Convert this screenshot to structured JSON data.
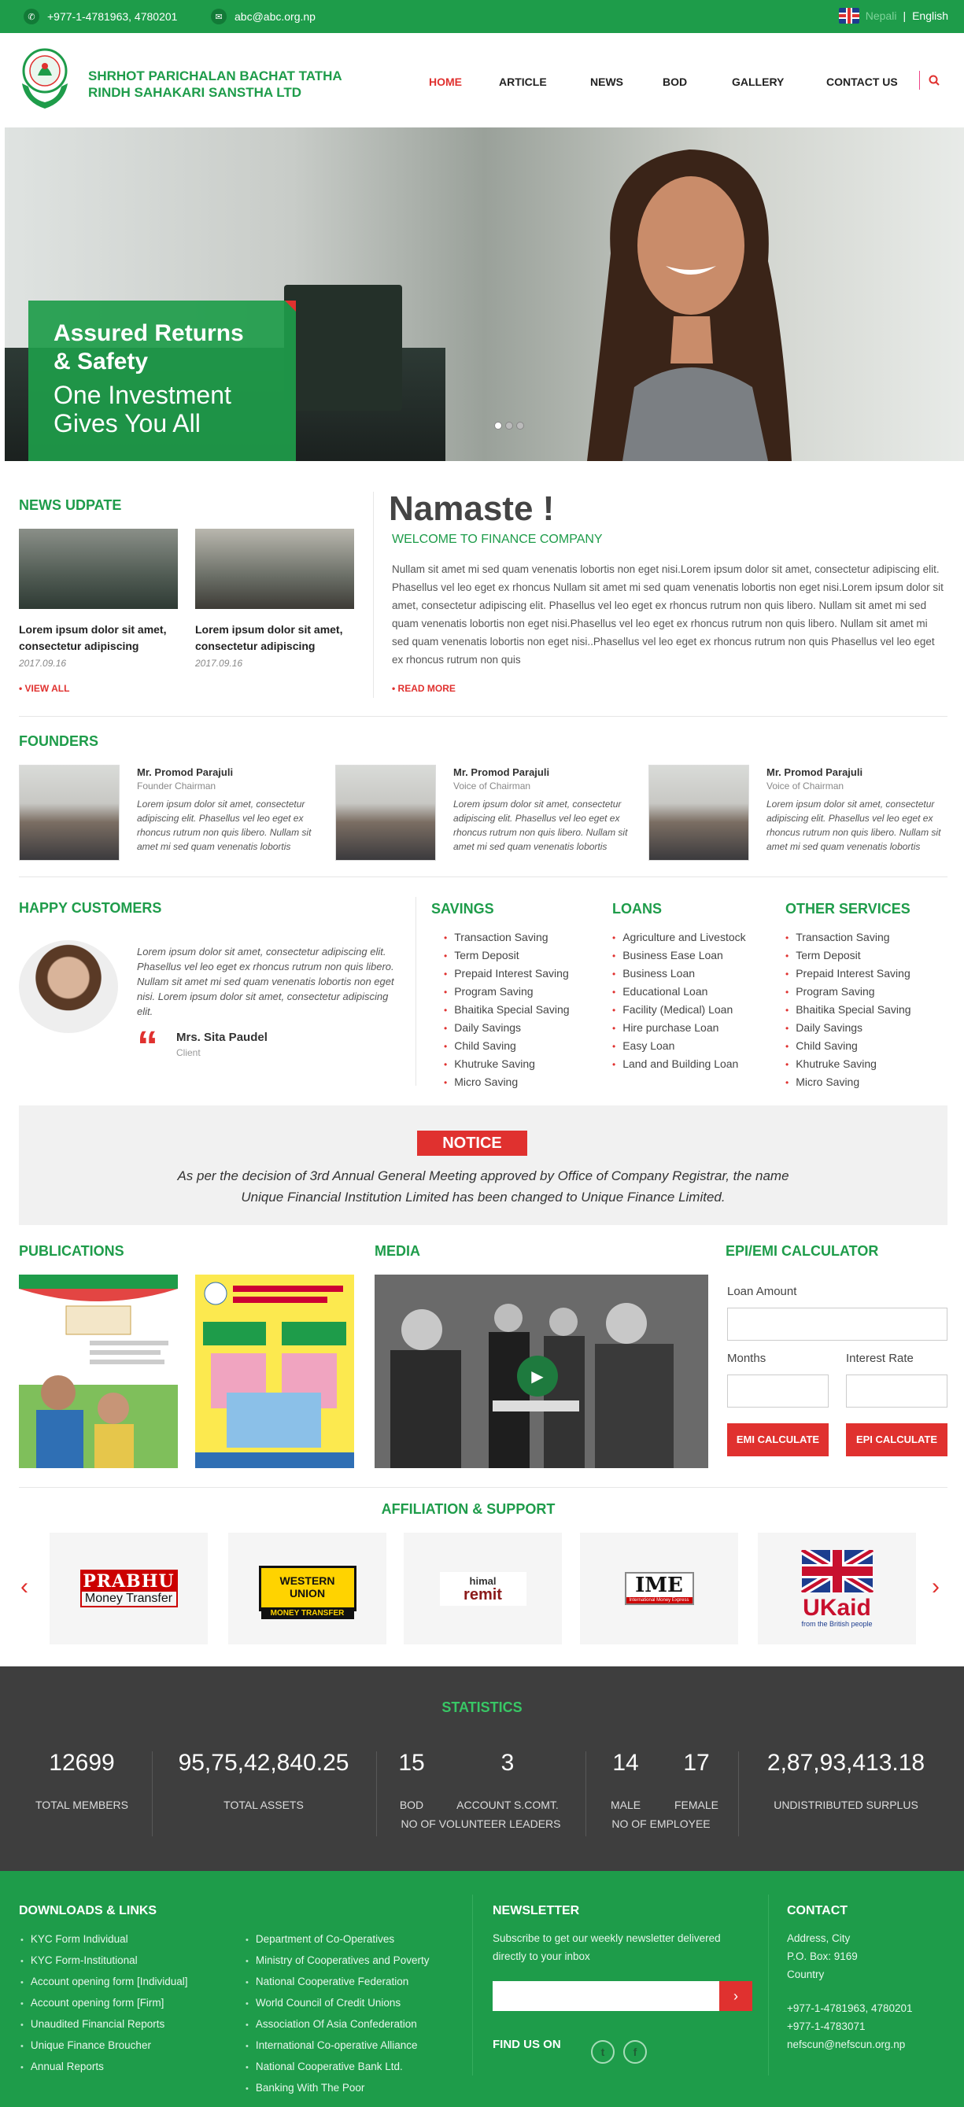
{
  "topbar": {
    "phone": "+977-1-4781963, 4780201",
    "email": "abc@abc.org.np",
    "lang_nepali": "Nepali",
    "lang_sep": "|",
    "lang_english": "English"
  },
  "brand": {
    "line1": "SHRHOT PARICHALAN BACHAT TATHA",
    "line2": "RINDH SAHAKARI SANSTHA LTD"
  },
  "nav": [
    "HOME",
    "ARTICLE",
    "NEWS",
    "BOD",
    "GALLERY",
    "CONTACT US"
  ],
  "hero": {
    "title1": "Assured Returns",
    "title2": "& Safety",
    "sub1": "One Investment",
    "sub2": "Gives You All"
  },
  "news": {
    "title": "NEWS UDPATE",
    "items": [
      {
        "line1": "Lorem ipsum dolor sit amet,",
        "line2": "consectetur adipiscing",
        "date": "2017.09.16"
      },
      {
        "line1": "Lorem ipsum dolor sit amet,",
        "line2": "consectetur adipiscing",
        "date": "2017.09.16"
      }
    ],
    "view_all": "VIEW ALL"
  },
  "welcome": {
    "heading": "Namaste !",
    "sub": "WELCOME TO FINANCE COMPANY",
    "body": "Nullam sit amet mi sed quam venenatis lobortis non eget nisi.Lorem ipsum dolor sit amet, consectetur adipiscing elit. Phasellus vel leo eget ex rhoncus Nullam sit amet mi sed quam venenatis lobortis non eget nisi.Lorem ipsum dolor sit amet, consectetur adipiscing elit. Phasellus vel leo eget ex rhoncus rutrum non quis libero. Nullam sit amet mi sed quam venenatis lobortis non eget nisi.Phasellus vel leo eget ex rhoncus rutrum non quis libero. Nullam sit amet mi sed quam venenatis lobortis non eget nisi..Phasellus vel leo eget ex rhoncus rutrum non quis Phasellus vel leo eget ex rhoncus rutrum non quis",
    "read_more": "READ MORE"
  },
  "founders": {
    "title": "FOUNDERS",
    "items": [
      {
        "name": "Mr. Promod Parajuli",
        "role": "Founder Chairman",
        "desc": "Lorem ipsum dolor sit amet, consectetur adipiscing elit. Phasellus vel leo eget ex rhoncus rutrum non quis libero. Nullam sit amet mi sed quam venenatis lobortis"
      },
      {
        "name": "Mr. Promod Parajuli",
        "role": "Voice of Chairman",
        "desc": "Lorem ipsum dolor sit amet, consectetur adipiscing elit. Phasellus vel leo eget ex rhoncus rutrum non quis libero. Nullam sit amet mi sed quam venenatis lobortis"
      },
      {
        "name": "Mr. Promod Parajuli",
        "role": "Voice of Chairman",
        "desc": "Lorem ipsum dolor sit amet, consectetur adipiscing elit. Phasellus vel leo eget ex rhoncus rutrum non quis libero. Nullam sit amet mi sed quam venenatis lobortis"
      }
    ]
  },
  "happy": {
    "title": "HAPPY CUSTOMERS",
    "quote": "Lorem ipsum dolor sit amet, consectetur adipiscing elit. Phasellus vel leo eget ex rhoncus rutrum non quis libero. Nullam sit amet mi sed quam venenatis lobortis non eget nisi. Lorem ipsum dolor sit amet, consectetur adipiscing elit.",
    "name": "Mrs. Sita Paudel",
    "role": "Client"
  },
  "savings": {
    "title": "SAVINGS",
    "items": [
      "Transaction Saving",
      "Term Deposit",
      "Prepaid Interest Saving",
      "Program Saving",
      "Bhaitika Special Saving",
      "Daily Savings",
      "Child Saving",
      "Khutruke Saving",
      "Micro Saving"
    ]
  },
  "loans": {
    "title": "LOANS",
    "items": [
      "Agriculture and Livestock",
      "Business Ease Loan",
      "Business Loan",
      "Educational Loan",
      "Facility (Medical) Loan",
      "Hire purchase Loan",
      "Easy Loan",
      "Land and Building Loan"
    ]
  },
  "other": {
    "title": "OTHER SERVICES",
    "items": [
      "Transaction Saving",
      "Term Deposit",
      "Prepaid Interest Saving",
      "Program Saving",
      "Bhaitika Special Saving",
      "Daily Savings",
      "Child Saving",
      "Khutruke Saving",
      "Micro Saving"
    ]
  },
  "notice": {
    "badge": "NOTICE",
    "line1": "As per the decision of 3rd Annual General Meeting approved by Office of Company Registrar, the name",
    "line2": "Unique Financial Institution Limited has been changed to Unique Finance Limited."
  },
  "publications": {
    "title": "PUBLICATIONS"
  },
  "media": {
    "title": "MEDIA"
  },
  "calculator": {
    "title": "EPI/EMI CALCULATOR",
    "loan_label": "Loan Amount",
    "months_label": "Months",
    "rate_label": "Interest Rate",
    "emi_button": "EMI CALCULATE",
    "epi_button": "EPI CALCULATE"
  },
  "affiliation": {
    "title": "AFFILIATION & SUPPORT",
    "logos": [
      {
        "line1": "PRABHU",
        "line2": "Money Transfer"
      },
      {
        "line1": "WESTERN UNION",
        "line2": "MONEY TRANSFER"
      },
      {
        "line1": "himal",
        "line2": "remit"
      },
      {
        "line1": "IME",
        "line2": "International Money Express"
      },
      {
        "line1": "UKaid",
        "line2": "from the British people"
      }
    ]
  },
  "stats": {
    "title": "STATISTICS",
    "members": "12699",
    "members_label": "TOTAL MEMBERS",
    "assets": "95,75,42,840.25",
    "assets_label": "TOTAL ASSETS",
    "bod": "15",
    "bod_label": "BOD",
    "acc": "3",
    "acc_label": "ACCOUNT S.COMT.",
    "volunteer_label": "NO OF VOLUNTEER LEADERS",
    "male": "14",
    "male_label": "MALE",
    "female": "17",
    "female_label": "FEMALE",
    "employee_label": "NO OF EMPLOYEE",
    "surplus": "2,87,93,413.18",
    "surplus_label": "UNDISTRIBUTED SURPLUS"
  },
  "footer": {
    "downloads_title": "DOWNLOADS & LINKS",
    "downloads": [
      "KYC Form Individual",
      "KYC Form-Institutional",
      "Account opening form [Individual]",
      "Account opening form [Firm]",
      "Unaudited Financial Reports",
      "Unique Finance Broucher",
      "Annual Reports"
    ],
    "links": [
      "Department of Co-Operatives",
      "Ministry of Cooperatives and Poverty",
      "National Cooperative Federation",
      "World Council of Credit Unions",
      "Association Of Asia Confederation",
      "International Co-operative Alliance",
      "National Cooperative Bank Ltd.",
      "Banking With The Poor"
    ],
    "newsletter_title": "NEWSLETTER",
    "newsletter_text1": "Subscribe to get our weekly newsletter delivered",
    "newsletter_text2": "directly to your inbox",
    "find_us": "FIND US ON",
    "contact_title": "CONTACT",
    "contact": [
      "Address, City",
      "P.O. Box: 9169",
      "Country",
      "",
      "+977-1-4781963, 4780201",
      "+977-1-4783071",
      "nefscun@nefscun.org.np"
    ]
  }
}
